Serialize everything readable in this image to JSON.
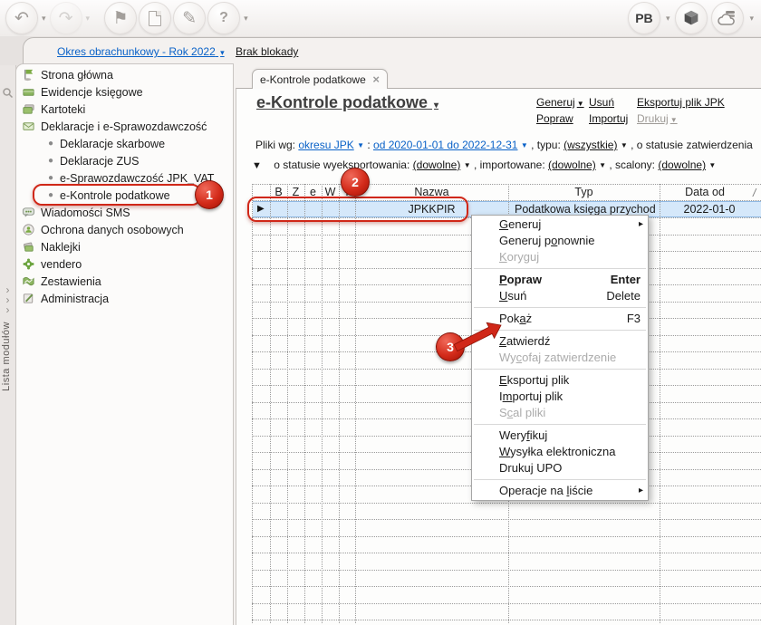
{
  "toolbar": {
    "user_initials": "PB",
    "icons": [
      {
        "name": "back",
        "glyph": "↶"
      },
      {
        "name": "forward",
        "glyph": "↷"
      },
      {
        "name": "start-flag",
        "glyph": "⚑"
      },
      {
        "name": "sign",
        "glyph": "✎"
      },
      {
        "name": "help",
        "glyph": "?"
      }
    ]
  },
  "header": {
    "period_link": "Okres obrachunkowy - Rok 2022",
    "lock_link": "Brak blokady"
  },
  "module_strip": {
    "label": "Lista modułów"
  },
  "sidebar": {
    "items": [
      {
        "label": "Strona główna"
      },
      {
        "label": "Ewidencje księgowe"
      },
      {
        "label": "Kartoteki"
      },
      {
        "label": "Deklaracje i e-Sprawozdawczość",
        "children": [
          {
            "label": "Deklaracje skarbowe"
          },
          {
            "label": "Deklaracje ZUS"
          },
          {
            "label": "e-Sprawozdawczość JPK_VAT"
          },
          {
            "label": "e-Kontrole podatkowe"
          }
        ]
      },
      {
        "label": "Wiadomości SMS"
      },
      {
        "label": "Ochrona danych osobowych"
      },
      {
        "label": "Naklejki"
      },
      {
        "label": "vendero"
      },
      {
        "label": "Zestawienia"
      },
      {
        "label": "Administracja"
      }
    ]
  },
  "tab": {
    "label": "e-Kontrole podatkowe"
  },
  "page": {
    "title": "e-Kontrole podatkowe"
  },
  "actions": {
    "generate": "Generuj",
    "delete": "Usuń",
    "export_jpk": "Eksportuj plik JPK",
    "edit": "Popraw",
    "import": "Importuj",
    "print": "Drukuj"
  },
  "filters": {
    "row1": {
      "prefix": "Pliki wg:",
      "period_link": "okresu JPK",
      "colon": ":",
      "range_link": "od 2020-01-01 do 2022-12-31",
      "type_label": ", typu:",
      "type_value": "(wszystkie)",
      "suffix": ", o statusie zatwierdzenia"
    },
    "row2": {
      "export_label": "o statusie wyeksportowania:",
      "export_value": "(dowolne)",
      "import_label": ", importowane:",
      "import_value": "(dowolne)",
      "merge_label": ", scalony:",
      "merge_value": "(dowolne)"
    }
  },
  "table": {
    "columns": {
      "flag1": "B",
      "flag2": "Z",
      "flag3": "e",
      "flag4": "W",
      "flag5": "I",
      "name": "Nazwa",
      "type": "Typ",
      "date_from": "Data od"
    },
    "sort_mark": "/",
    "row": {
      "name": "JPKKPIR",
      "type": "Podatkowa księga przychod",
      "date_from": "2022-01-0"
    }
  },
  "context_menu": {
    "items": [
      {
        "pre": "",
        "accel": "G",
        "post": "eneruj",
        "shortcut": ""
      },
      {
        "pre": "Generuj p",
        "accel": "o",
        "post": "nownie",
        "shortcut": ""
      },
      {
        "pre": "",
        "accel": "K",
        "post": "oryguj",
        "shortcut": ""
      },
      {
        "pre": "",
        "accel": "P",
        "post": "opraw",
        "shortcut": "Enter"
      },
      {
        "pre": "",
        "accel": "U",
        "post": "suń",
        "shortcut": "Delete"
      },
      {
        "pre": "Pok",
        "accel": "a",
        "post": "ż",
        "shortcut": "F3"
      },
      {
        "pre": "",
        "accel": "Z",
        "post": "atwierdź",
        "shortcut": ""
      },
      {
        "pre": "Wy",
        "accel": "c",
        "post": "ofaj zatwierdzenie",
        "shortcut": ""
      },
      {
        "pre": "",
        "accel": "E",
        "post": "ksportuj plik",
        "shortcut": ""
      },
      {
        "pre": "I",
        "accel": "m",
        "post": "portuj plik",
        "shortcut": ""
      },
      {
        "pre": "S",
        "accel": "c",
        "post": "al pliki",
        "shortcut": ""
      },
      {
        "pre": "Wery",
        "accel": "f",
        "post": "ikuj",
        "shortcut": ""
      },
      {
        "pre": "",
        "accel": "W",
        "post": "ysyłka elektroniczna",
        "shortcut": ""
      },
      {
        "pre": "Druku",
        "accel": "j",
        "post": " UPO",
        "shortcut": ""
      },
      {
        "pre": "Operacje na ",
        "accel": "l",
        "post": "iście",
        "shortcut": ""
      }
    ]
  },
  "annotations": {
    "step1": "1",
    "step2": "2",
    "step3": "3"
  },
  "glyphs": {
    "caret_down": "▾",
    "dropdown_small": "▼",
    "submenu_arrow": "▸",
    "row_marker": "▶",
    "tab_close": "×",
    "chevron": "›"
  },
  "colors": {
    "link_blue": "#0a62c8",
    "annotation_red": "#d02718",
    "selection_blue": "#d5e8fa"
  }
}
